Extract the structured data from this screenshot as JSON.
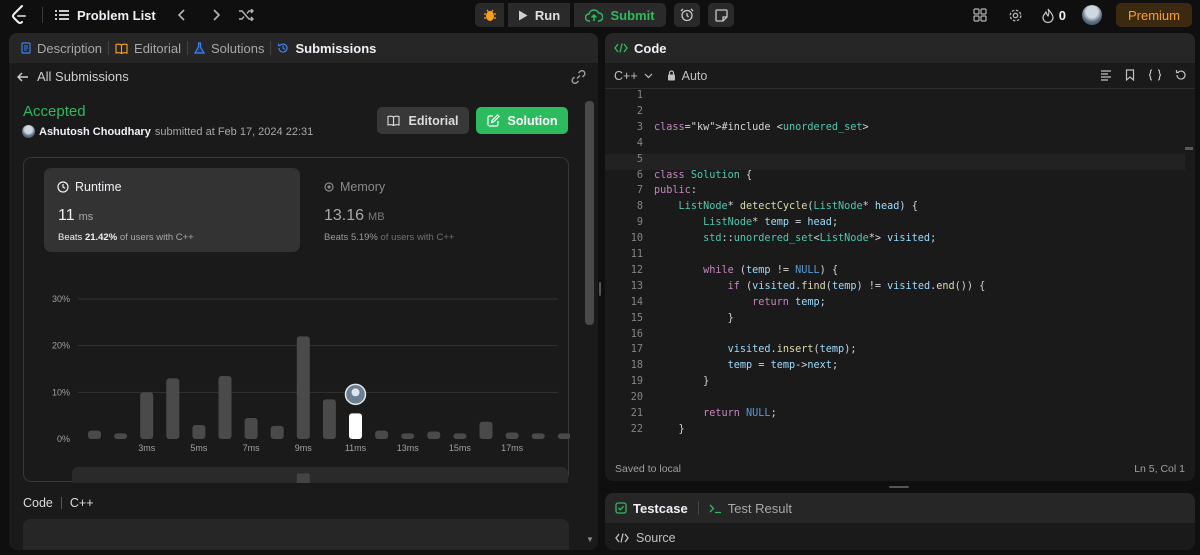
{
  "topbar": {
    "problem_list": "Problem List",
    "run": "Run",
    "submit": "Submit",
    "streak": "0",
    "premium": "Premium"
  },
  "left": {
    "tabs": [
      {
        "label": "Description"
      },
      {
        "label": "Editorial"
      },
      {
        "label": "Solutions"
      },
      {
        "label": "Submissions"
      }
    ],
    "all_submissions": "All Submissions",
    "status": "Accepted",
    "user": "Ashutosh Choudhary",
    "submitted_text": "submitted at Feb 17, 2024 22:31",
    "editorial_btn": "Editorial",
    "solution_btn": "Solution",
    "runtime": {
      "label": "Runtime",
      "value": "11",
      "unit": "ms",
      "beats_prefix": "Beats",
      "beats": "21.42%",
      "beats_suffix": "of users with C++"
    },
    "memory": {
      "label": "Memory",
      "value": "13.16",
      "unit": "MB",
      "beats_prefix": "Beats",
      "beats": "5.19%",
      "beats_suffix": "of users with C++"
    },
    "code_label": "Code",
    "code_lang": "C++"
  },
  "chart_data": {
    "type": "bar",
    "ylabel_ticks": [
      "30%",
      "20%",
      "10%",
      "0%"
    ],
    "ylim": [
      0,
      30
    ],
    "x_tick_labels": [
      "3ms",
      "5ms",
      "7ms",
      "9ms",
      "11ms",
      "13ms",
      "15ms",
      "17ms"
    ],
    "values": [
      1.8,
      1.2,
      10,
      13,
      3,
      13.5,
      4.5,
      2.8,
      22,
      8.5,
      5.5,
      1.8,
      1.2,
      1.6,
      1.2,
      3.7,
      1.4,
      1.2,
      1.2
    ],
    "highlight_index": 10,
    "highlight_color": "#ffffff",
    "bar_color": "#4a4a4a"
  },
  "right": {
    "title": "Code",
    "lang": "C++",
    "mode": "Auto",
    "saved": "Saved to local",
    "cursor": "Ln 5, Col 1",
    "testcase": "Testcase",
    "test_result": "Test Result",
    "source": "Source"
  },
  "code": [
    {
      "n": "1",
      "t": ""
    },
    {
      "n": "2",
      "t": ""
    },
    {
      "n": "3",
      "t": "#include <unordered_set>"
    },
    {
      "n": "4",
      "t": ""
    },
    {
      "n": "5",
      "t": ""
    },
    {
      "n": "6",
      "t": "class Solution {"
    },
    {
      "n": "7",
      "t": "public:"
    },
    {
      "n": "8",
      "t": "    ListNode* detectCycle(ListNode* head) {"
    },
    {
      "n": "9",
      "t": "        ListNode* temp = head;"
    },
    {
      "n": "10",
      "t": "        std::unordered_set<ListNode*> visited;"
    },
    {
      "n": "11",
      "t": ""
    },
    {
      "n": "12",
      "t": "        while (temp != NULL) {"
    },
    {
      "n": "13",
      "t": "            if (visited.find(temp) != visited.end()) {"
    },
    {
      "n": "14",
      "t": "                return temp;"
    },
    {
      "n": "15",
      "t": "            }"
    },
    {
      "n": "16",
      "t": ""
    },
    {
      "n": "17",
      "t": "            visited.insert(temp);"
    },
    {
      "n": "18",
      "t": "            temp = temp->next;"
    },
    {
      "n": "19",
      "t": "        }"
    },
    {
      "n": "20",
      "t": ""
    },
    {
      "n": "21",
      "t": "        return NULL;"
    },
    {
      "n": "22",
      "t": "    }"
    }
  ]
}
